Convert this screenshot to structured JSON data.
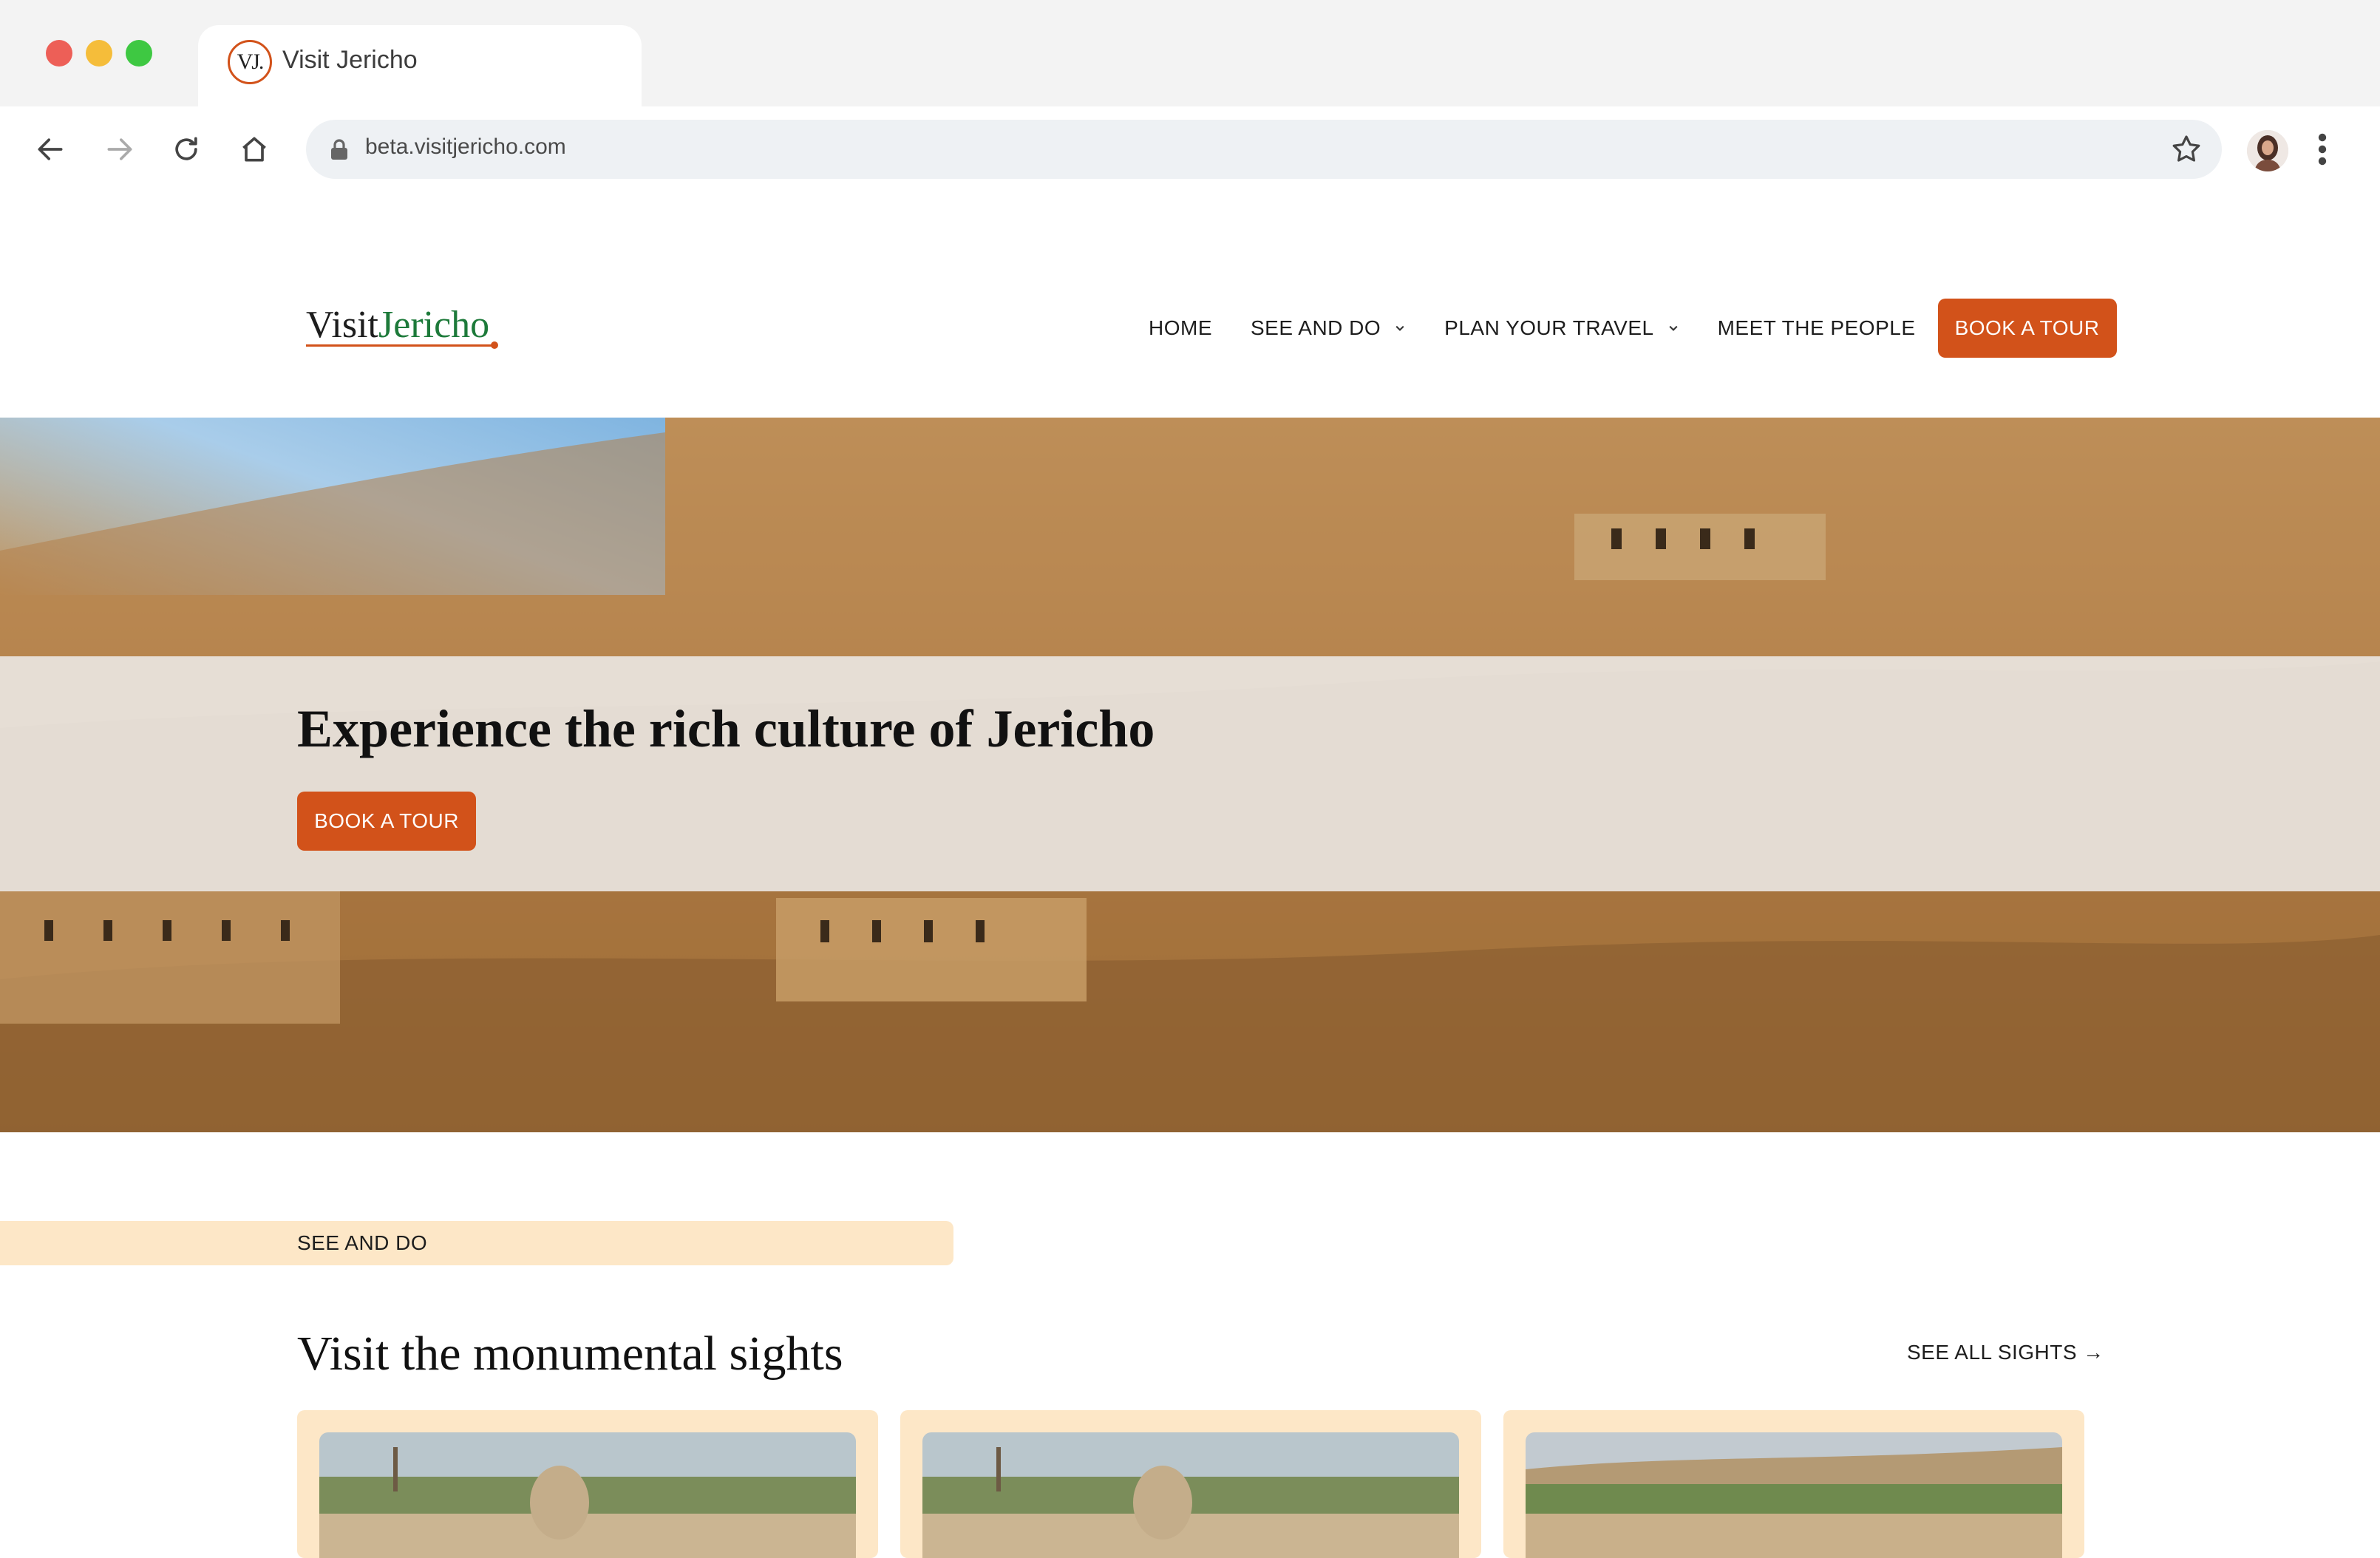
{
  "browser": {
    "tab_title": "Visit Jericho",
    "favicon_text": "VJ.",
    "url": "beta.visitjericho.com"
  },
  "site": {
    "logo_prefix": "Visit",
    "logo_accent": "Jericho",
    "accent_color": "#d2521a",
    "logo_accent_color": "#1d7a3a"
  },
  "nav": {
    "items": [
      {
        "label": "HOME",
        "has_dropdown": false
      },
      {
        "label": "SEE AND DO",
        "has_dropdown": true
      },
      {
        "label": "PLAN YOUR TRAVEL",
        "has_dropdown": true
      },
      {
        "label": "MEET THE PEOPLE",
        "has_dropdown": false
      }
    ],
    "cta_label": "BOOK A TOUR"
  },
  "hero": {
    "title": "Experience the rich culture of Jericho",
    "cta_label": "BOOK A TOUR"
  },
  "section": {
    "tag": "SEE AND DO",
    "title": "Visit the monumental sights",
    "see_all_label": "SEE ALL SIGHTS",
    "see_all_arrow": "→",
    "tag_background": "#fde7c7"
  }
}
